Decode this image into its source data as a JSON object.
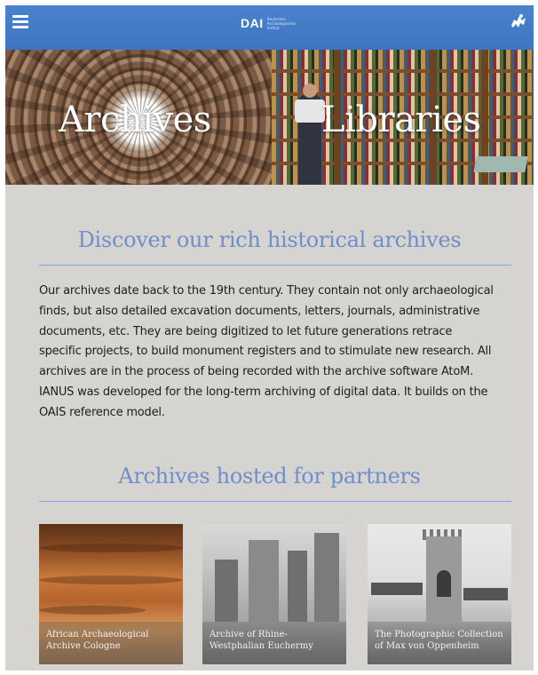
{
  "header": {
    "brand_name": "DAI",
    "brand_subtitle": "Deutsches Archäologisches Institut",
    "menu_icon": "hamburger-menu-icon",
    "language_icon": "language-switch-icon"
  },
  "hero": {
    "archives_label": "Archives",
    "libraries_label": "Libraries"
  },
  "discover": {
    "heading": "Discover our rich historical archives",
    "lines": [
      "Our archives date back to the 19th century. They contain not only archaeological",
      "finds, but also detailed excavation documents, letters, journals, administrative",
      "documents, etc. They are being digitized to let future generations retrace",
      "specific projects, to build monument registers and to stimulate new research. All",
      "archives are in the process of being recorded with the archive software AtoM.",
      "IANUS was developed for the long-term archiving of digital data. It builds on the",
      "OAIS reference model."
    ]
  },
  "partners": {
    "heading": "Archives hosted for partners",
    "cards": [
      {
        "caption": "African Archaeological Archive Cologne"
      },
      {
        "caption": "Archive of Rhine-Westphalian Euchermy"
      },
      {
        "caption": "The Photographic Collection of Max von Oppenheim"
      }
    ]
  },
  "colors": {
    "topbar": "#4a82cc",
    "heading": "#6e8fcc",
    "page_background": "#d5d4d1"
  }
}
